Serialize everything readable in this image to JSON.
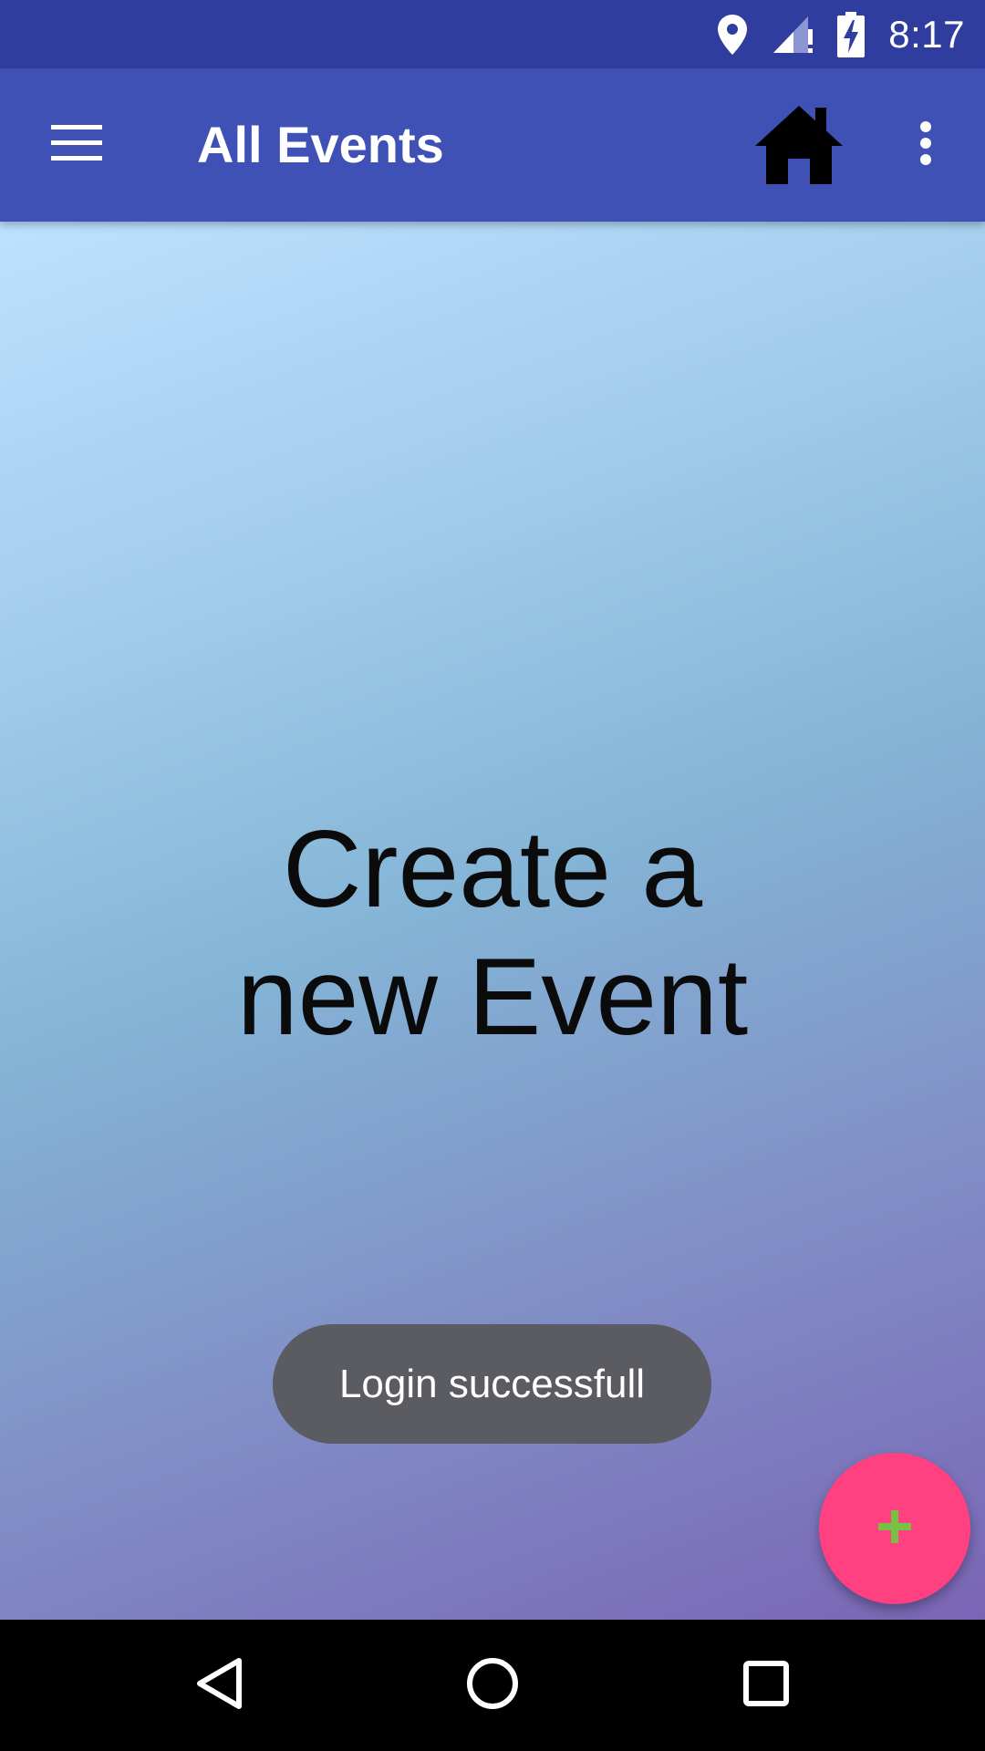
{
  "status_bar": {
    "time": "8:17",
    "icons": [
      "location-icon",
      "signal-icon",
      "battery-charging-icon"
    ],
    "background": "#2f3d9f"
  },
  "app_bar": {
    "title": "All Events",
    "menu_icon": "menu-icon",
    "home_icon": "home-icon",
    "overflow_icon": "more-vert-icon",
    "background": "#3f51b5"
  },
  "content": {
    "message_line1": "Create a",
    "message_line2": "new Event"
  },
  "toast": {
    "text": "Login successfull"
  },
  "fab": {
    "icon": "plus-icon",
    "background": "#ff4081",
    "icon_color": "#76c043"
  },
  "nav_bar": {
    "buttons": [
      "back-icon",
      "home-circle-icon",
      "recents-icon"
    ]
  }
}
